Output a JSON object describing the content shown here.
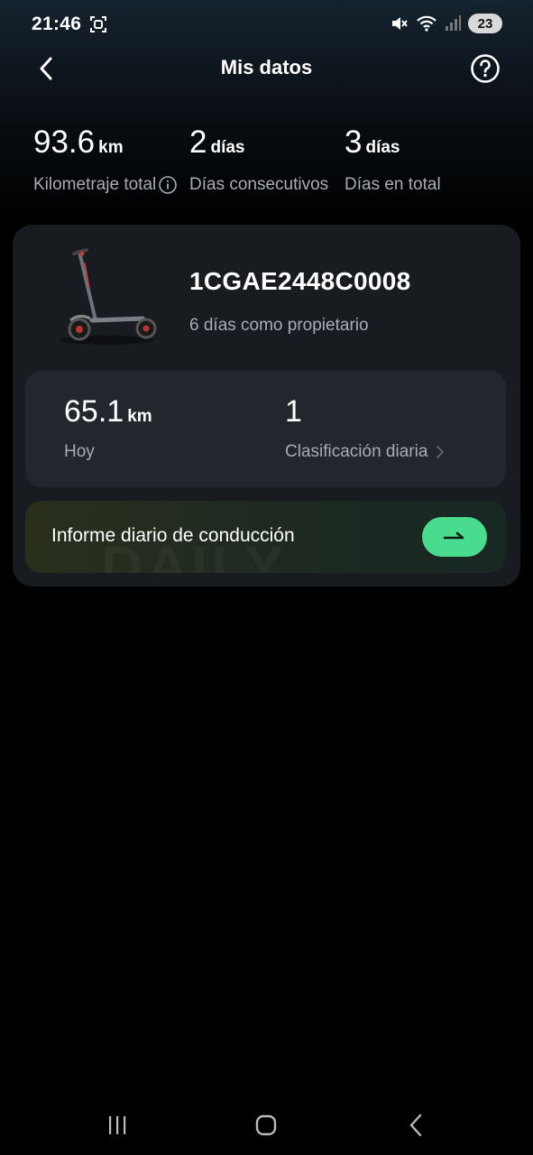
{
  "status_bar": {
    "time": "21:46",
    "battery": "23",
    "icons": [
      "screenshot-icon",
      "mute-icon",
      "wifi-icon",
      "signal-icon"
    ]
  },
  "header": {
    "title": "Mis datos",
    "back_icon": "chevron-left-icon",
    "help_icon": "question-circle-icon"
  },
  "stats": [
    {
      "value": "93.6",
      "unit": "km",
      "label": "Kilometraje total"
    },
    {
      "value": "2",
      "unit": "días",
      "label": "Días consecutivos"
    },
    {
      "value": "3",
      "unit": "días",
      "label": "Días en total"
    }
  ],
  "vehicle": {
    "serial": "1CGAE2448C0008",
    "ownership": "6 días como propietario"
  },
  "today": {
    "value": "65.1",
    "unit": "km",
    "label": "Hoy",
    "rank_value": "1",
    "rank_label": "Clasificación diaria"
  },
  "report": {
    "label": "Informe diario de conducción",
    "watermark": "DAILY"
  },
  "colors": {
    "accent": "#49dc8f",
    "card": "#181b20",
    "inner_card": "#22262d",
    "muted_text": "#a7adb4"
  }
}
